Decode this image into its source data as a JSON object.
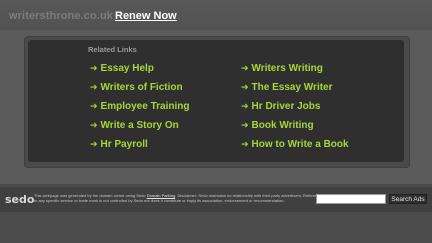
{
  "header": {
    "domain": "writersthrone.co.uk",
    "renew_label": "Renew Now"
  },
  "related": {
    "title": "Related Links",
    "left_links": [
      {
        "label": "Essay Help"
      },
      {
        "label": "Writers of Fiction"
      },
      {
        "label": "Employee Training"
      },
      {
        "label": "Write a Story On"
      },
      {
        "label": "Hr Payroll"
      }
    ],
    "right_links": [
      {
        "label": "Writers Writing"
      },
      {
        "label": "The Essay Writer"
      },
      {
        "label": "Hr Driver Jobs"
      },
      {
        "label": "Book Writing"
      },
      {
        "label": "How to Write a Book"
      }
    ],
    "arrow_icon": "arrow-right-icon"
  },
  "footer": {
    "logo_text": "sedo",
    "disclaimer_prefix": "This webpage was generated by the domain owner using Sedo ",
    "disclaimer_link": "Domain Parking",
    "disclaimer_suffix": ". Disclaimer: Sedo maintains no relationship with third party advertisers. Reference to any specific service or trade mark is not controlled by Sedo nor does it constitute or imply its association, endorsement or recommendation.",
    "search_placeholder": "",
    "search_button": "Search Ads"
  },
  "colors": {
    "background": "#5b5b5b",
    "panel": "#2f2f2f",
    "link": "#a8d63a",
    "domain_text": "#7c7c7c"
  }
}
